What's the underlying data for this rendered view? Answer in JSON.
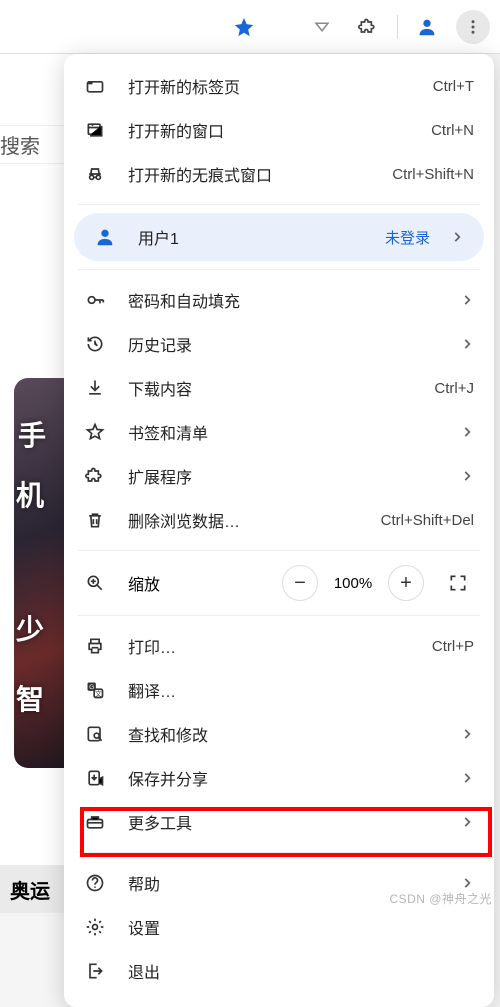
{
  "toolbar": {
    "star_color": "#1a66d6"
  },
  "bg": {
    "search": "搜索",
    "bottom": "奥运",
    "ch1": "手",
    "ch2": "机",
    "ch3": "少",
    "ch4": "智"
  },
  "menu": {
    "new_tab": {
      "label": "打开新的标签页",
      "shortcut": "Ctrl+T"
    },
    "new_window": {
      "label": "打开新的窗口",
      "shortcut": "Ctrl+N"
    },
    "incognito": {
      "label": "打开新的无痕式窗口",
      "shortcut": "Ctrl+Shift+N"
    },
    "profile": {
      "label": "用户1",
      "status": "未登录"
    },
    "passwords": {
      "label": "密码和自动填充"
    },
    "history": {
      "label": "历史记录"
    },
    "downloads": {
      "label": "下载内容",
      "shortcut": "Ctrl+J"
    },
    "bookmarks": {
      "label": "书签和清单"
    },
    "extensions": {
      "label": "扩展程序"
    },
    "clear_data": {
      "label": "删除浏览数据…",
      "shortcut": "Ctrl+Shift+Del"
    },
    "zoom": {
      "label": "缩放",
      "value": "100%"
    },
    "print": {
      "label": "打印…",
      "shortcut": "Ctrl+P"
    },
    "translate": {
      "label": "翻译…"
    },
    "find": {
      "label": "查找和修改"
    },
    "save_share": {
      "label": "保存并分享"
    },
    "more_tools": {
      "label": "更多工具"
    },
    "help": {
      "label": "帮助"
    },
    "settings": {
      "label": "设置"
    },
    "exit": {
      "label": "退出"
    }
  },
  "watermark": "CSDN @神舟之光"
}
